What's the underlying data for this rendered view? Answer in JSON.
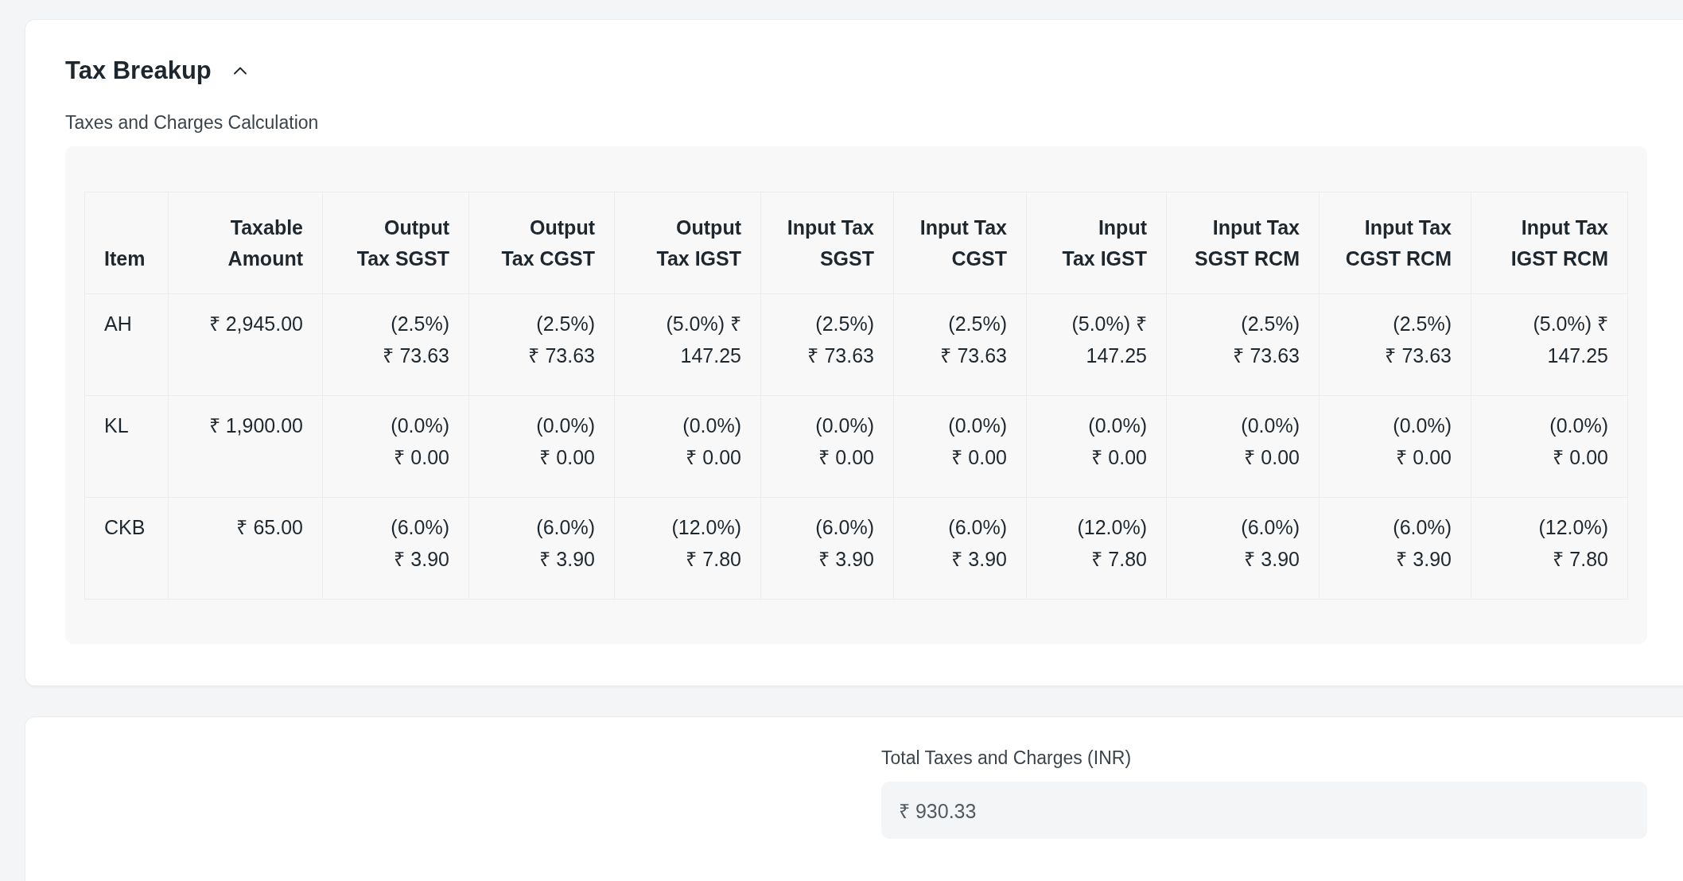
{
  "section": {
    "title": "Tax Breakup",
    "expanded": true,
    "caption": "Taxes and Charges Calculation"
  },
  "table": {
    "columns": [
      "Item",
      "Taxable Amount",
      "Output Tax SGST",
      "Output Tax CGST",
      "Output Tax IGST",
      "Input Tax SGST",
      "Input Tax CGST",
      "Input Tax IGST",
      "Input Tax SGST RCM",
      "Input Tax CGST RCM",
      "Input Tax IGST RCM"
    ],
    "rows": [
      [
        "AH",
        "₹ 2,945.00",
        "(2.5%) ₹ 73.63",
        "(2.5%) ₹ 73.63",
        "(5.0%) ₹ 147.25",
        "(2.5%) ₹ 73.63",
        "(2.5%) ₹ 73.63",
        "(5.0%) ₹ 147.25",
        "(2.5%) ₹ 73.63",
        "(2.5%) ₹ 73.63",
        "(5.0%) ₹ 147.25"
      ],
      [
        "KL",
        "₹ 1,900.00",
        "(0.0%) ₹ 0.00",
        "(0.0%) ₹ 0.00",
        "(0.0%) ₹ 0.00",
        "(0.0%) ₹ 0.00",
        "(0.0%) ₹ 0.00",
        "(0.0%) ₹ 0.00",
        "(0.0%) ₹ 0.00",
        "(0.0%) ₹ 0.00",
        "(0.0%) ₹ 0.00"
      ],
      [
        "CKB",
        "₹ 65.00",
        "(6.0%) ₹ 3.90",
        "(6.0%) ₹ 3.90",
        "(12.0%) ₹ 7.80",
        "(6.0%) ₹ 3.90",
        "(6.0%) ₹ 3.90",
        "(12.0%) ₹ 7.80",
        "(6.0%) ₹ 3.90",
        "(6.0%) ₹ 3.90",
        "(12.0%) ₹ 7.80"
      ]
    ]
  },
  "total": {
    "label": "Total Taxes and Charges (INR)",
    "value": "₹ 930.33"
  }
}
